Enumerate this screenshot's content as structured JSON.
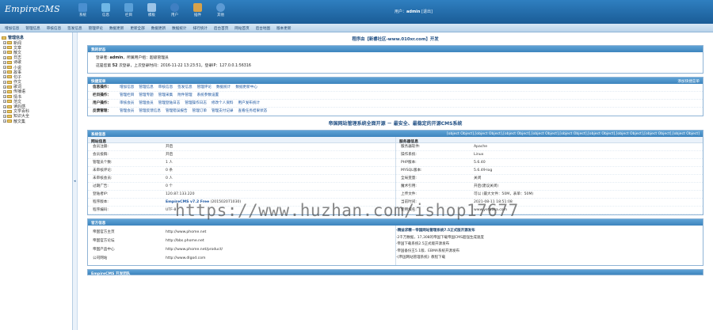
{
  "header": {
    "logo": "EmpireCMS",
    "nav": [
      {
        "label": "系统",
        "icon": "system-icon",
        "color": "#4a8fd0"
      },
      {
        "label": "信息",
        "icon": "info-icon",
        "color": "#6fb7e6"
      },
      {
        "label": "栏目",
        "icon": "folder-icon",
        "color": "#5aa0d8"
      },
      {
        "label": "模板",
        "icon": "template-icon",
        "color": "#9bc4e8"
      },
      {
        "label": "用户",
        "icon": "user-icon",
        "color": "#3f7fc2"
      },
      {
        "label": "插件",
        "icon": "plugin-icon",
        "color": "#d8a24a"
      },
      {
        "label": "其他",
        "icon": "other-icon",
        "color": "#5c9ad4"
      }
    ],
    "user_prefix": "用户：",
    "username": "admin",
    "logout": "[退出]"
  },
  "menubar": [
    "增加信息",
    "管理信息",
    "审核信息",
    "签发信息",
    "管理评论",
    "数据更新",
    "更新全部",
    "数据更新",
    "数据统计",
    "排行统计",
    "后台首页",
    "网站首页",
    "后台地图",
    "版本更新"
  ],
  "tree": {
    "root": "管理信息",
    "items": [
      "新闻",
      "文章",
      "散文",
      "日志",
      "诗歌",
      "小说",
      "故事",
      "句子",
      "作文",
      "歌词",
      "传播语",
      "情书",
      "范文",
      "读后感",
      "文学百科",
      "知识大全",
      "散文集"
    ]
  },
  "notice": "程序由【新睿社区-www.010xr.com】开发",
  "status": {
    "title": "我的状态",
    "line1_label": "登录者:",
    "line1_user": "admin",
    "line1_rest": "，所属用户组：超级管理员",
    "line2_a": "这是您第",
    "line2_count": "52",
    "line2_b": "次登录，上次登录时间：2016-11-22 13:23:51，登录IP：127.0.0.1:56316"
  },
  "quick": {
    "title": "快捷菜单",
    "right": "添加快捷菜单",
    "rows": [
      {
        "cat": "信息操作：",
        "links": [
          "增加信息",
          "管理信息",
          "审核信息",
          "签发信息",
          "管理评论",
          "数据统计",
          "数据更新中心"
        ]
      },
      {
        "cat": "栏目操作：",
        "links": [
          "管理栏目",
          "管理专题",
          "管理采集",
          "附件管理",
          "系统参数设置"
        ]
      },
      {
        "cat": "用户操作：",
        "links": [
          "审核会员",
          "管理会员",
          "管理登陆日志",
          "管理操作日志",
          "修改个人资料",
          "用户发布统计"
        ]
      },
      {
        "cat": "反馈管理：",
        "links": [
          "管理会员",
          "管理反馈信息",
          "管理错误报告",
          "管理订单",
          "管理支付记录",
          "查看任务结果状态"
        ]
      }
    ]
  },
  "slogan": "帝国网站管理系统全面开源 － 最安全、最稳定的开源CMS系统",
  "sysinfo": {
    "title": "系统信息",
    "right": [
      {
        "k": "服务器软件:",
        "v": "Apache"
      },
      {
        "k": "操作系统:",
        "v": "Linux"
      },
      {
        "k": "PHP版本:",
        "v": "5.6.40"
      },
      {
        "k": "MYSQL版本:",
        "v": "5.6.49-log"
      },
      {
        "k": "全局变量:",
        "v": "关闭"
      },
      {
        "k": "魔术引用:",
        "v": "开启(建议关闭)"
      },
      {
        "k": "上传文件:",
        "v": "可以 (最大文件：50M，表单：50M)"
      },
      {
        "k": "当前时间:",
        "v": "2021-08-11 18:51:08"
      },
      {
        "k": "使用域名:",
        "v": "www.yetbaka.com"
      }
    ],
    "left_head": "网站信息",
    "right_head": "服务器信息",
    "left": [
      {
        "k": "会员注册:",
        "v": "开启"
      },
      {
        "k": "会员投稿:",
        "v": "开启"
      },
      {
        "k": "管理员个数:",
        "v": "1 人"
      },
      {
        "k": "未审核评论:",
        "v": "0 条"
      },
      {
        "k": "未审核会员:",
        "v": "0 人"
      },
      {
        "k": "过期广告:",
        "v": "0 个"
      },
      {
        "k": "登陆者IP:",
        "v": "120.87.133.220"
      },
      {
        "k": "程序版本:",
        "v": "EmpireCMS v7.2 Free",
        "extra": "(201502071030)"
      },
      {
        "k": "程序编码:",
        "v": "UTF-8"
      }
    ]
  },
  "official": {
    "title": "官方信息",
    "rows": [
      {
        "k": "帝国官方主页",
        "v": "http://www.phome.net"
      },
      {
        "k": "帝国官方论坛",
        "v": "http://bbs.phome.net"
      },
      {
        "k": "帝国产品中心",
        "v": "http://www.phome.net/product/"
      },
      {
        "k": "公司网站",
        "v": "http://www.dlgod.com"
      }
    ],
    "news": [
      "·精益求精－帝国网站管理系统7.5正式版开源发布",
      "·2千万数据，17,308的帝国下载帝国CMS超强生成速度",
      "·帝国下载系统2.5正式版开源发布",
      "·帝国备份王5.1版、EBMA系统开源发布",
      "·《帝国网站管理系统》教程下载"
    ]
  },
  "team_title": "EmpireCMS 开发团队",
  "watermark": "https://www.huzhan.com/ishop17677"
}
